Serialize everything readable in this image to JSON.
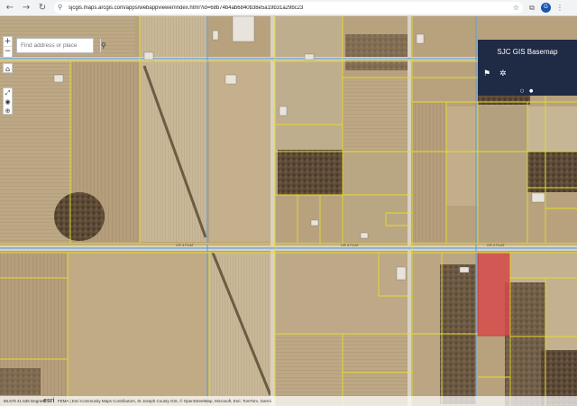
{
  "browser": {
    "url": "sjcgis.maps.arcgis.com/apps/webappviewer/index.html?id=68b74b4ab6840b38e5a19b31a29bc23",
    "back_icon": "←",
    "forward_icon": "→",
    "reload_icon": "↻",
    "lock_icon": "⚲",
    "bookmark_icon": "☆",
    "extension_icon": "⧉",
    "menu_icon": "⋮",
    "profile_initial": "G"
  },
  "map": {
    "search_placeholder": "Find address or place",
    "search_icon": "⚲",
    "zoom_in": "+",
    "zoom_out": "−",
    "home_icon": "⌂",
    "locate_icons": [
      "⤢",
      "◉",
      "⊕"
    ],
    "basemap_title": "SJC GIS Basemap",
    "basemap_buttons": [
      "⚑",
      "✲"
    ],
    "page_dots": "○ ●",
    "road_labels": [
      "CR 4 PLAT",
      "CR 4 PLAT",
      "CR 4 PLAT"
    ],
    "coords": "86.678 41.535 Degrees",
    "esri_logo": "esri",
    "attribution": "FEMA | Esri Community Maps Contributors, St Joseph County GIS, © OpenStreetMap, Microsoft, Esri, TomTom, Garmi"
  },
  "colors": {
    "parcel_line": "#e6dc2c",
    "road_line": "#6aa0d8",
    "highlight_fill": "#d84a4a",
    "panel_bg": "#1f2a44",
    "field_base": "#b8a27e"
  }
}
